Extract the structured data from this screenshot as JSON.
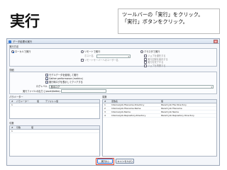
{
  "slide": {
    "title": "実行",
    "callout": [
      "ツールバーの「実行」をクリック。",
      "「実行」ボタンをクリック。"
    ]
  },
  "dialog": {
    "title": "データ処理の実行",
    "close_label": "✕",
    "exec_target": {
      "heading": "実行方法",
      "options": [
        {
          "label": "ローカルで実行",
          "selected": true
        },
        {
          "label": "リモートで実行",
          "selected": false
        },
        {
          "label": "クラスタで実行",
          "selected": false
        }
      ],
      "remote_host_label": "ホスト名",
      "remote_server_label": "リモートサーバーへのユーザー名",
      "cluster_checks": [
        "ジョブを優先する",
        "実行記録を保存する",
        "実行を完了する",
        "ジョブを再開する"
      ]
    },
    "options": {
      "heading": "詳細",
      "checks": [
        {
          "label": "モデルデータを使用して実行",
          "checked": true
        },
        {
          "label": "Gather performance (metrics)",
          "checked": true
        },
        {
          "label": "実行時ログを表示してクリアする",
          "checked": true
        }
      ],
      "log_level_label": "ログレベル",
      "log_level_value": "基本ログ",
      "output_file_label": "実行ファイルの出力 [ \\work\\Kettle\\...]"
    },
    "params": {
      "heading": "パラメーター",
      "columns": [
        "#",
        "パラメーター",
        "値",
        "デフォルト値"
      ],
      "rows": [
        {
          "n": "1"
        }
      ]
    },
    "vars_small": {
      "heading": "引数",
      "columns": [
        "#",
        "引数",
        "値"
      ],
      "rows": [
        {
          "n": "1"
        }
      ]
    },
    "variables": {
      "heading": "変数",
      "columns": [
        "#",
        "変数名",
        "値"
      ],
      "rows": [
        {
          "n": "1",
          "name": "Internal.Job.Filename.Directory",
          "value": "Parent Job File Directory"
        },
        {
          "n": "2",
          "name": "Internal.Job.Filename.Name",
          "value": "Parent Job Filename"
        },
        {
          "n": "3",
          "name": "Internal.Job.Name",
          "value": "Parent Job Name"
        },
        {
          "n": "4",
          "name": "Internal.Job.Repository.Directory",
          "value": "Parent Job Repository Directory"
        }
      ]
    },
    "buttons": {
      "run": "実行(L)",
      "cancel": "キャンセル(C)"
    }
  }
}
